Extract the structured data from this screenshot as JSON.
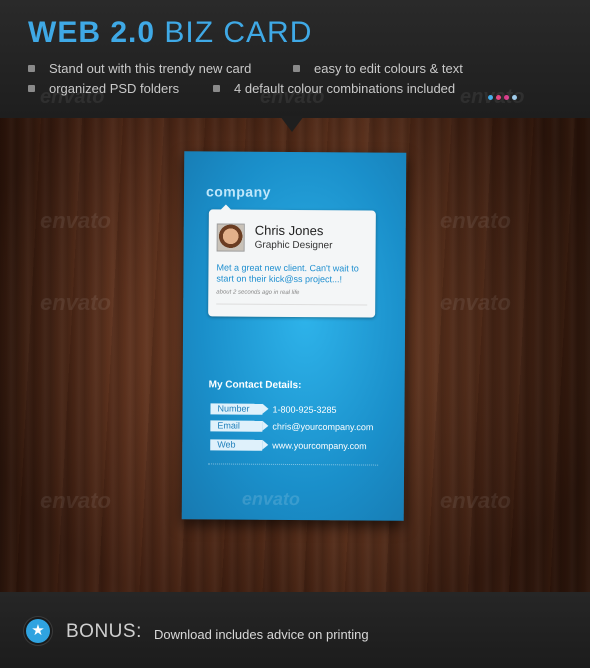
{
  "header": {
    "title_bold": "WEB 2.0",
    "title_light": "BIZ CARD",
    "features": [
      "Stand out with this trendy new card",
      "easy to edit colours & text",
      "organized PSD folders",
      "4 default colour combinations included"
    ],
    "swatch_colors": [
      "#3fa9e6",
      "#e0407a",
      "#d83b8a",
      "#9ac8e8"
    ],
    "accent_color": "#3fa9e6"
  },
  "watermark": "envato",
  "card": {
    "logo": "company",
    "profile": {
      "name": "Chris Jones",
      "role": "Graphic Designer",
      "status": "Met a great new client.  Can't wait to start on their kick@ss project...!",
      "time": "about 2 seconds ago in real life"
    },
    "contact_heading": "My Contact Details:",
    "contacts": [
      {
        "label": "Number",
        "value": "1-800-925-3285"
      },
      {
        "label": "Email",
        "value": "chris@yourcompany.com"
      },
      {
        "label": "Web",
        "value": "www.yourcompany.com"
      }
    ]
  },
  "footer": {
    "star_icon": "★",
    "bonus_label": "BONUS:",
    "bonus_text": "Download includes advice on printing"
  }
}
